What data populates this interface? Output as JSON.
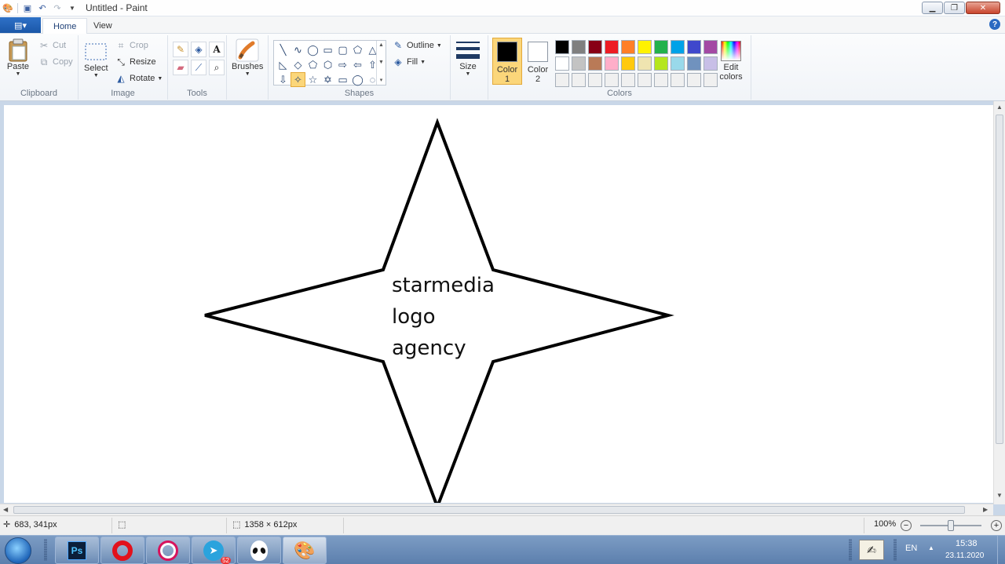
{
  "window": {
    "title": "Untitled - Paint"
  },
  "tabs": {
    "file": "▾",
    "home": "Home",
    "view": "View"
  },
  "clipboard": {
    "label": "Clipboard",
    "paste": "Paste",
    "cut": "Cut",
    "copy": "Copy"
  },
  "image": {
    "label": "Image",
    "select": "Select",
    "crop": "Crop",
    "resize": "Resize",
    "rotate": "Rotate"
  },
  "tools": {
    "label": "Tools"
  },
  "brushes": {
    "label": "Brushes"
  },
  "shapes": {
    "label": "Shapes",
    "outline": "Outline",
    "fill": "Fill"
  },
  "size": {
    "label": "Size"
  },
  "colors": {
    "label": "Colors",
    "color1": "Color",
    "color1_num": "1",
    "color2": "Color",
    "color2_num": "2",
    "edit": "Edit",
    "edit2": "colors",
    "color1_value": "#000000",
    "color2_value": "#ffffff",
    "palette": [
      "#000000",
      "#7f7f7f",
      "#880015",
      "#ed1c24",
      "#ff7f27",
      "#fff200",
      "#22b14c",
      "#00a2e8",
      "#3f48cc",
      "#a349a4",
      "#ffffff",
      "#c3c3c3",
      "#b97a57",
      "#ffaec9",
      "#ffc90e",
      "#efe4b0",
      "#b5e61d",
      "#99d9ea",
      "#7092be",
      "#c8bfe7",
      "#f0f0f0",
      "#f0f0f0",
      "#f0f0f0",
      "#f0f0f0",
      "#f0f0f0",
      "#f0f0f0",
      "#f0f0f0",
      "#f0f0f0",
      "#f0f0f0",
      "#f0f0f0"
    ]
  },
  "canvas": {
    "lines": [
      "starmedia",
      "logo",
      "agency"
    ]
  },
  "status": {
    "cursor": "683, 341px",
    "canvas_size": "1358 × 612px",
    "zoom": "100%",
    "zoom_fraction": 0.5
  },
  "taskbar": {
    "lang": "EN",
    "time": "15:38",
    "date": "23.11.2020",
    "ps": "Ps",
    "telegram_badge": "52"
  }
}
